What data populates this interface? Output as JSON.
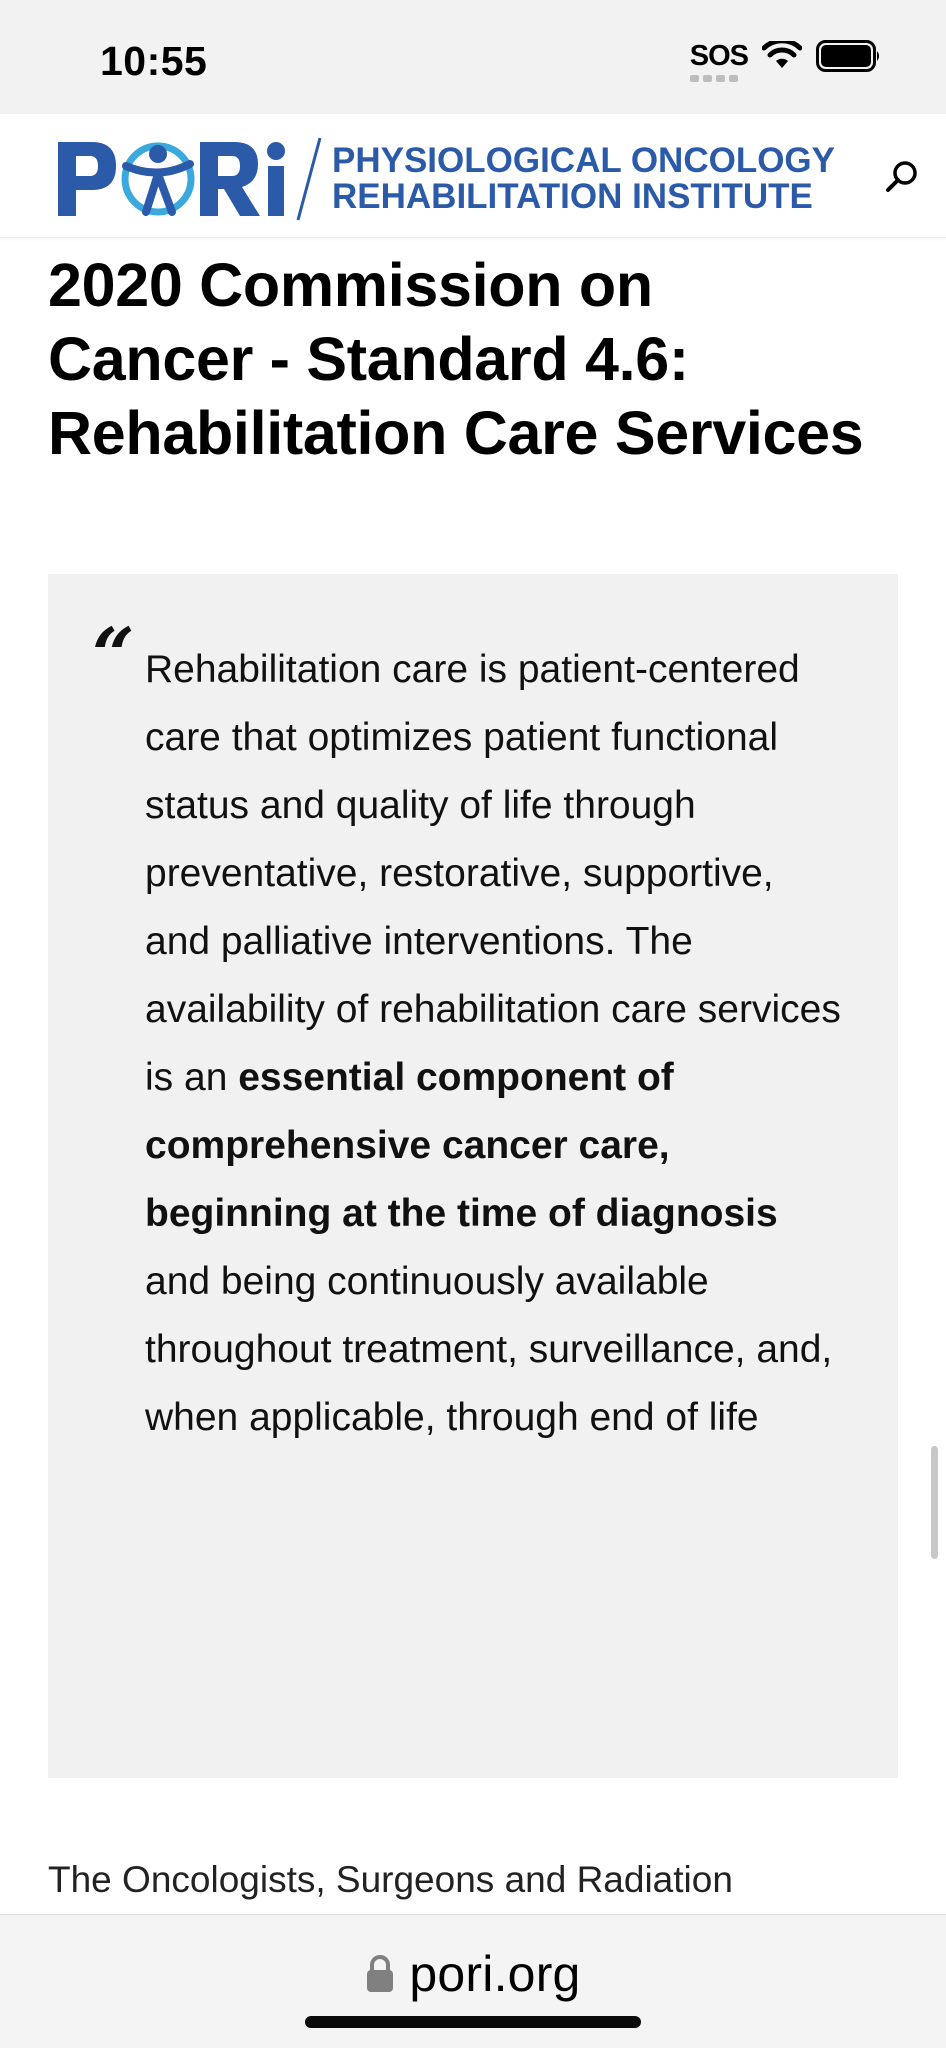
{
  "status_bar": {
    "time": "10:55",
    "sos": "SOS",
    "icons": [
      "wifi-icon",
      "battery-icon"
    ]
  },
  "header": {
    "logo_line1": "PHYSIOLOGICAL ONCOLOGY",
    "logo_line2": "REHABILITATION INSTITUTE",
    "logo_letters": "PORi",
    "search_icon": "search-icon",
    "brand_color": "#2a5aa8"
  },
  "article": {
    "title": "2020 Commission on Cancer - Standard 4.6: Rehabilitation Care Services",
    "quote": {
      "mark": "“",
      "text_before": "Rehabilitation care is patient-centered care that optimizes patient functional status and quality of life through preventative, restorative, supportive, and palliative interventions.  The availability of rehabilitation care services is an ",
      "text_bold": "essential component of comprehensive cancer care, beginning at the time of diagnosis",
      "text_after": " and being continuously available throughout treatment, surveillance, and, when applicable, through end of life"
    },
    "body_start": "The Oncologists, Surgeons and Radiation"
  },
  "browser": {
    "url": "pori.org",
    "lock_icon": "lock-icon"
  }
}
